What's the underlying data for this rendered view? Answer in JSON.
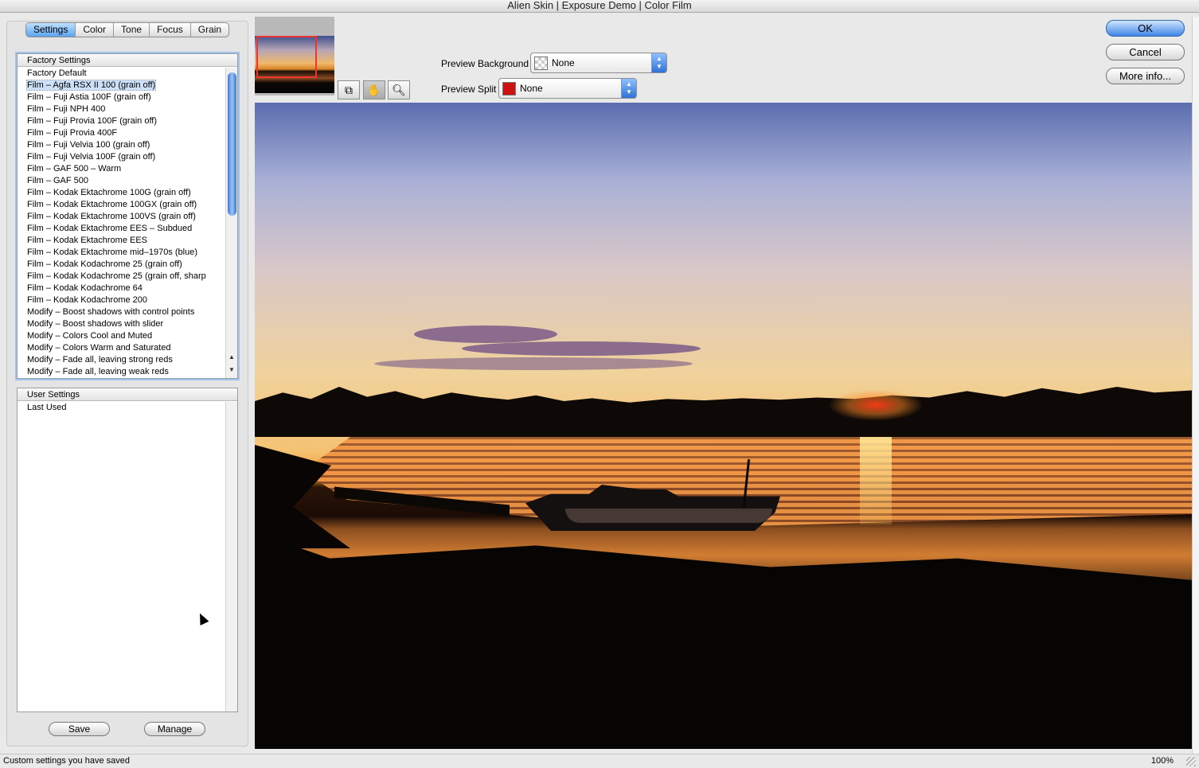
{
  "window": {
    "title": "Alien Skin | Exposure Demo | Color Film"
  },
  "tabs": [
    {
      "label": "Settings",
      "active": true
    },
    {
      "label": "Color",
      "active": false
    },
    {
      "label": "Tone",
      "active": false
    },
    {
      "label": "Focus",
      "active": false
    },
    {
      "label": "Grain",
      "active": false
    }
  ],
  "factory_settings": {
    "header": "Factory Settings",
    "items": [
      "Factory Default",
      "Film – Agfa RSX II 100 (grain off)",
      "Film – Fuji Astia 100F (grain off)",
      "Film – Fuji NPH 400",
      "Film – Fuji Provia 100F (grain off)",
      "Film – Fuji Provia 400F",
      "Film – Fuji Velvia 100 (grain off)",
      "Film – Fuji Velvia 100F (grain off)",
      "Film – GAF 500 – Warm",
      "Film – GAF 500",
      "Film – Kodak Ektachrome 100G (grain off)",
      "Film – Kodak Ektachrome 100GX (grain off)",
      "Film – Kodak Ektachrome 100VS (grain off)",
      "Film – Kodak Ektachrome EES – Subdued",
      "Film – Kodak Ektachrome EES",
      "Film – Kodak Ektachrome mid–1970s (blue)",
      "Film – Kodak Kodachrome  25 (grain off)",
      "Film – Kodak Kodachrome  25 (grain off, sharp",
      "Film – Kodak Kodachrome  64",
      "Film – Kodak Kodachrome 200",
      "Modify – Boost shadows with control points",
      "Modify – Boost shadows with slider",
      "Modify – Colors Cool and Muted",
      "Modify – Colors Warm and Saturated",
      "Modify – Fade all, leaving strong reds",
      "Modify – Fade all, leaving weak reds"
    ],
    "selected_index": 1
  },
  "user_settings": {
    "header": "User Settings",
    "items": [
      "Last Used"
    ]
  },
  "buttons": {
    "save": "Save",
    "manage": "Manage",
    "ok": "OK",
    "cancel": "Cancel",
    "more_info": "More info..."
  },
  "preview_controls": {
    "background_label": "Preview Background",
    "background_value": "None",
    "split_label": "Preview Split",
    "split_value": "None",
    "split_color": "#cc1111"
  },
  "status": {
    "text": "Custom settings you have saved",
    "zoom": "100%"
  }
}
